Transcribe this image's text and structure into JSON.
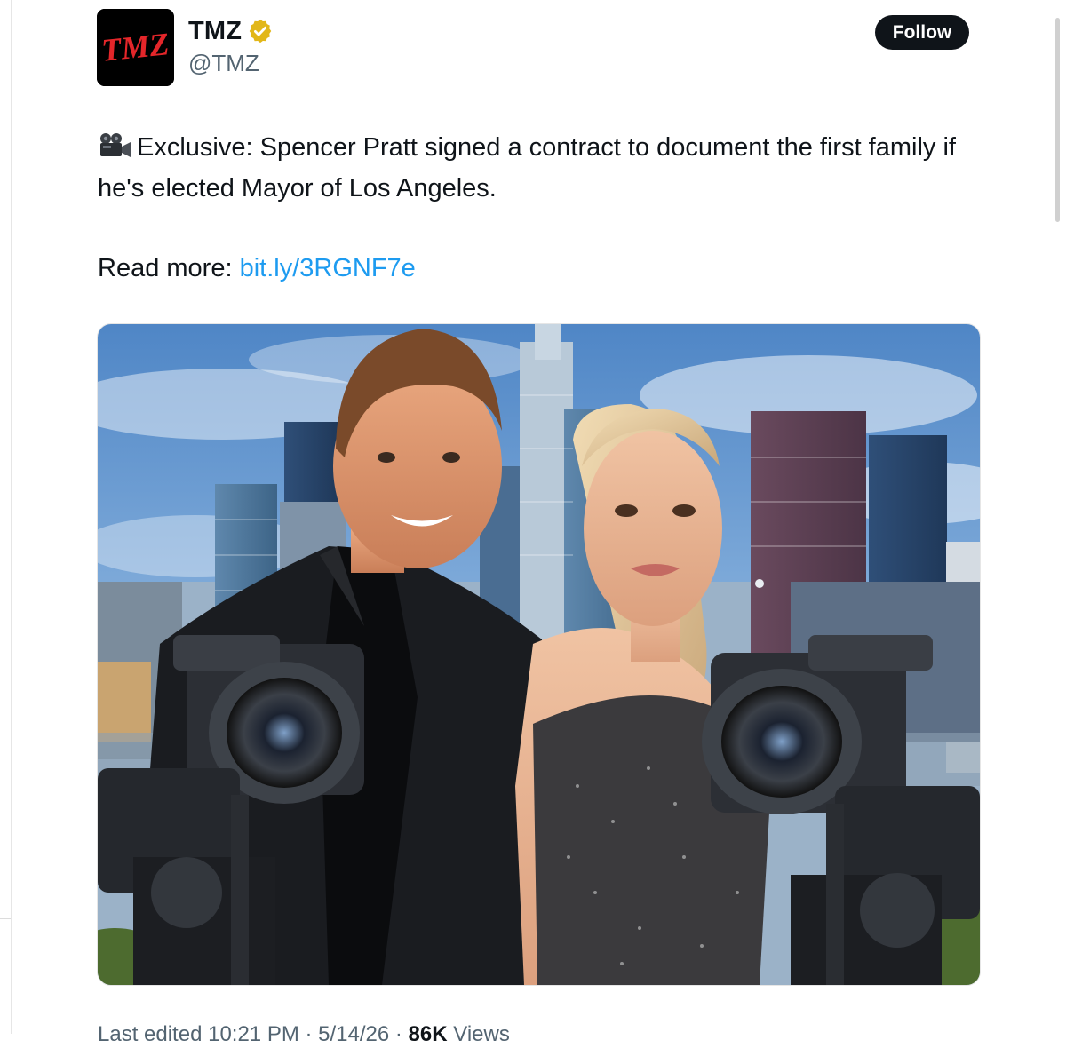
{
  "author": {
    "logo_text": "TMZ",
    "display_name": "TMZ",
    "handle": "@TMZ",
    "verified_badge": "gold-verified-icon"
  },
  "follow_button": {
    "label": "Follow"
  },
  "tweet": {
    "emoji": "movie-camera-icon",
    "text": "Exclusive: Spencer Pratt signed a contract to document the first family if he's elected Mayor of Los Angeles.",
    "read_more_label": "Read more: ",
    "link": "bit.ly/3RGNF7e"
  },
  "media": {
    "alt": "Photo of Spencer Pratt and Heidi Montag in front of the Los Angeles skyline with two video cameras"
  },
  "footer": {
    "edited": "Last edited 10:21 PM · 5/14/26 · ",
    "views_count": "86K",
    "views_label": " Views"
  },
  "colors": {
    "link": "#1d9bf0",
    "logo_red": "#e4262a",
    "badge_gold": "#e2b719",
    "follow_bg": "#0f1419"
  }
}
